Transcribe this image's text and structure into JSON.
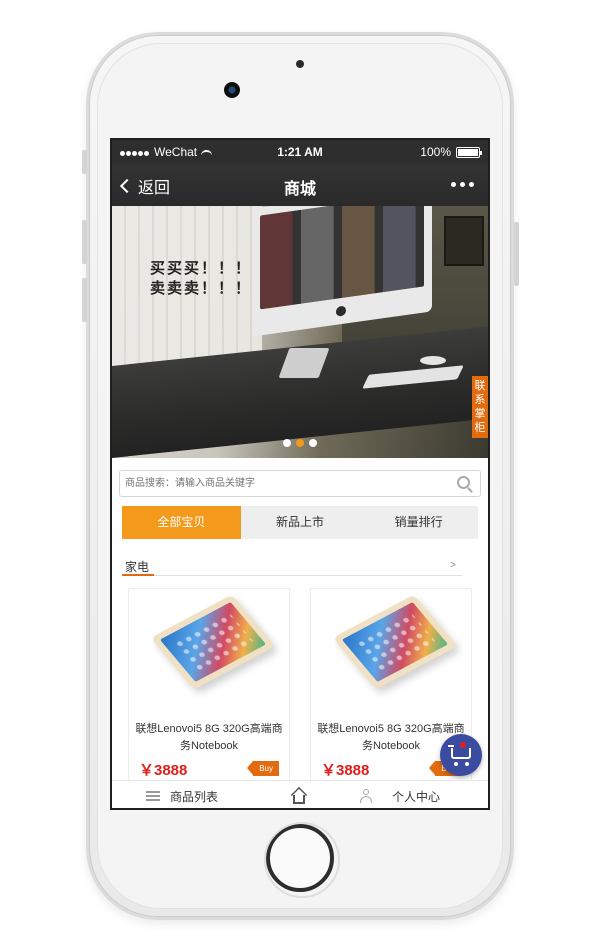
{
  "status_bar": {
    "carrier": "WeChat",
    "time": "1:21 AM",
    "battery": "100%",
    "battery_level": 1.0
  },
  "nav": {
    "back_label": "返回",
    "title": "商城",
    "more_icon": "more-dots-icon"
  },
  "banner": {
    "line1": "买买买！！！",
    "line2": "卖卖卖！！！",
    "contact_tab": "联系掌柜",
    "slide_count": 3,
    "active_slide": 2
  },
  "search": {
    "placeholder": "商品搜索：请输入商品关键字",
    "icon": "search-icon"
  },
  "tabs": [
    {
      "label": "全部宝贝",
      "active": true
    },
    {
      "label": "新品上市",
      "active": false
    },
    {
      "label": "销量排行",
      "active": false
    }
  ],
  "section": {
    "title": "家电",
    "more": ">"
  },
  "products": [
    {
      "name": "联想Lenovoi5 8G 320G高端商务Notebook",
      "price": "￥3888",
      "buy": "Buy"
    },
    {
      "name": "联想Lenovoi5 8G 320G高端商务Notebook",
      "price": "￥3888",
      "buy": "Buy"
    }
  ],
  "bottom_bar": {
    "list_label": "商品列表",
    "home_icon": "home-icon",
    "user_label": "个人中心"
  },
  "colors": {
    "accent": "#f39a1d",
    "buy_tag": "#e26b10",
    "price": "#e0201d",
    "cart_fab": "#3b4ca0",
    "nav_bg": "#2e2e2e"
  }
}
